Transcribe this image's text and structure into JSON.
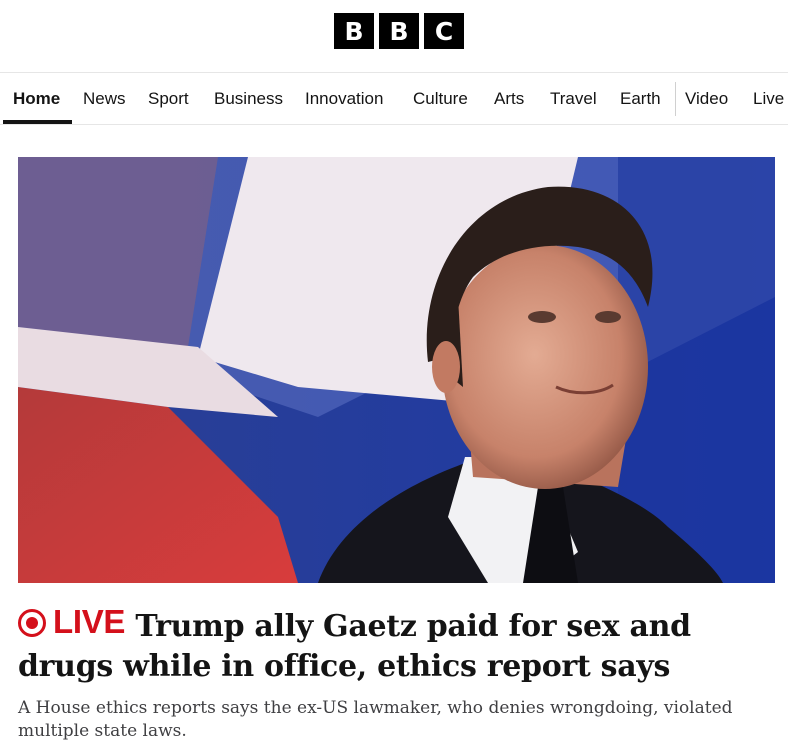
{
  "logo": {
    "letters": [
      "B",
      "B",
      "C"
    ]
  },
  "nav": {
    "items": [
      {
        "label": "Home",
        "active": true
      },
      {
        "label": "News"
      },
      {
        "label": "Sport"
      },
      {
        "label": "Business"
      },
      {
        "label": "Innovation"
      },
      {
        "label": "Culture"
      },
      {
        "label": "Arts"
      },
      {
        "label": "Travel"
      },
      {
        "label": "Earth"
      },
      {
        "label": "Video"
      },
      {
        "label": "Live"
      }
    ]
  },
  "story": {
    "live_label": "LIVE",
    "headline": "Trump ally Gaetz paid for sex and drugs while in office, ethics report says",
    "summary": "A House ethics reports says the ex-US lawmaker, who denies wrongdoing, violated multiple state laws."
  },
  "colors": {
    "live_red": "#d4101b",
    "text": "#141414",
    "summary_text": "#3f3f42"
  }
}
